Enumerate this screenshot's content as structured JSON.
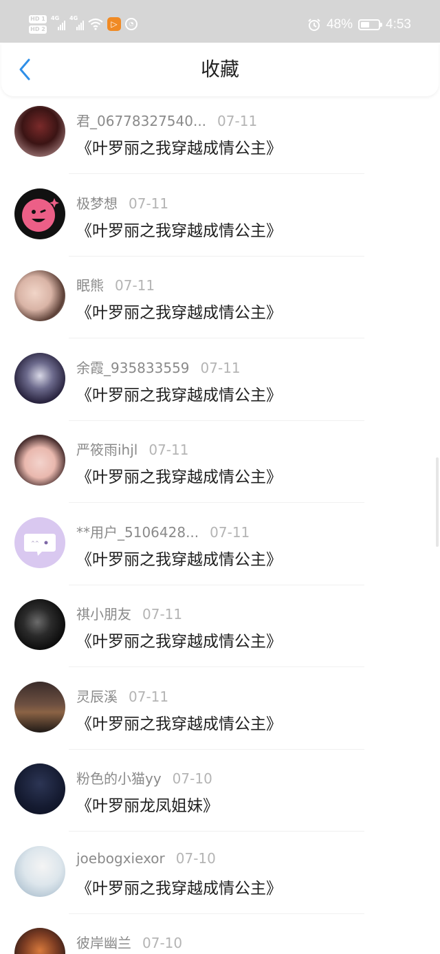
{
  "status_bar": {
    "hd_labels": [
      "HD 1",
      "HD 2"
    ],
    "network": [
      "4G",
      "4G"
    ],
    "app_badge": "▷",
    "battery": "48%",
    "battery_level": 0.48,
    "time": "4:53",
    "icons": [
      "signal-icon",
      "wifi-icon",
      "app-notification-icon",
      "alarm-icon",
      "battery-icon"
    ]
  },
  "nav": {
    "title": "收藏",
    "back_icon": "chevron-left-icon",
    "accent": "#2f8fe8"
  },
  "items": [
    {
      "user": "君_06778327540...",
      "date": "07-11",
      "book": "《叶罗丽之我穿越成情公主》"
    },
    {
      "user": "极梦想",
      "date": "07-11",
      "book": "《叶罗丽之我穿越成情公主》"
    },
    {
      "user": "眠熊",
      "date": "07-11",
      "book": "《叶罗丽之我穿越成情公主》"
    },
    {
      "user": "余霞_935833559",
      "date": "07-11",
      "book": "《叶罗丽之我穿越成情公主》"
    },
    {
      "user": "严筱雨ihjl",
      "date": "07-11",
      "book": "《叶罗丽之我穿越成情公主》"
    },
    {
      "user": "**用户_5106428...",
      "date": "07-11",
      "book": "《叶罗丽之我穿越成情公主》"
    },
    {
      "user": "祺小朋友",
      "date": "07-11",
      "book": "《叶罗丽之我穿越成情公主》"
    },
    {
      "user": "灵辰溪",
      "date": "07-11",
      "book": "《叶罗丽之我穿越成情公主》"
    },
    {
      "user": "粉色的小猫yy",
      "date": "07-10",
      "book": "《叶罗丽龙凤姐妹》"
    },
    {
      "user": "joebogxiexor",
      "date": "07-10",
      "book": "《叶罗丽之我穿越成情公主》"
    },
    {
      "user": "彼岸幽兰",
      "date": "07-10",
      "book": ""
    }
  ]
}
